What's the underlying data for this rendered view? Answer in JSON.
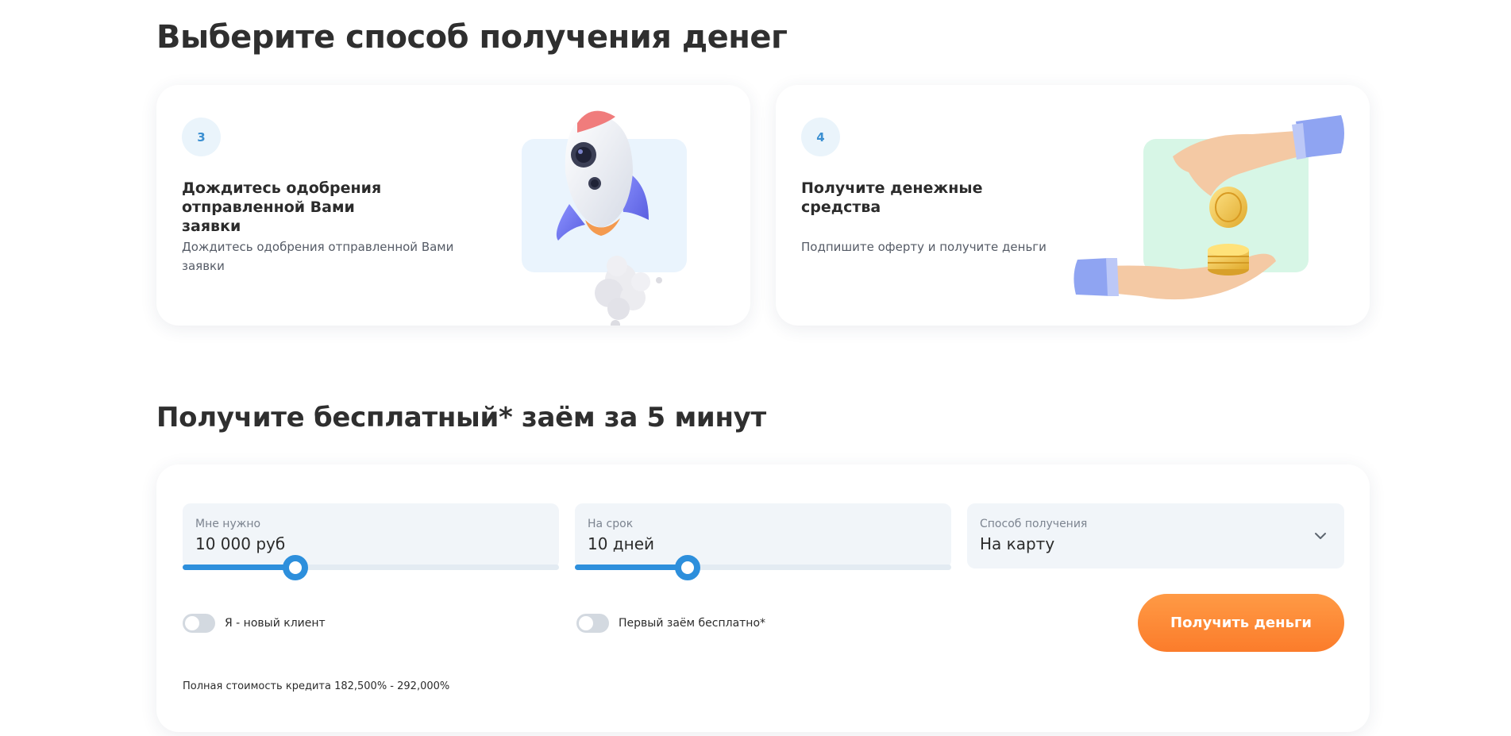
{
  "steps_section": {
    "title": "Выберите способ получения денег",
    "cards": [
      {
        "number": "3",
        "heading": "Дождитесь одобрения отправленной Вами заявки",
        "text": "Дождитесь одобрения отправленной Вами заявки",
        "illustration": "rocket"
      },
      {
        "number": "4",
        "heading": "Получите денежные средства",
        "text": "Подпишите оферту и получите деньги",
        "illustration": "hands-with-coins"
      }
    ]
  },
  "calculator": {
    "title": "Получите бесплатный* заём за 5 минут",
    "amount": {
      "label": "Мне нужно",
      "value": "10 000 руб",
      "slider_fraction": 0.3
    },
    "term": {
      "label": "На срок",
      "value": "10 дней",
      "slider_fraction": 0.3
    },
    "method": {
      "label": "Способ получения",
      "value": "На карту"
    },
    "toggles": {
      "new_client": {
        "label": "Я - новый клиент",
        "on": false
      },
      "first_free": {
        "label": "Первый заём бесплатно*",
        "on": false
      }
    },
    "submit_label": "Получить деньги",
    "cost_note": "Полная стоимость кредита 182,500% - 292,000%"
  },
  "colors": {
    "accent_blue": "#2d8fdc",
    "accent_orange": "#fb7c2b",
    "field_bg": "#f1f5f9"
  }
}
